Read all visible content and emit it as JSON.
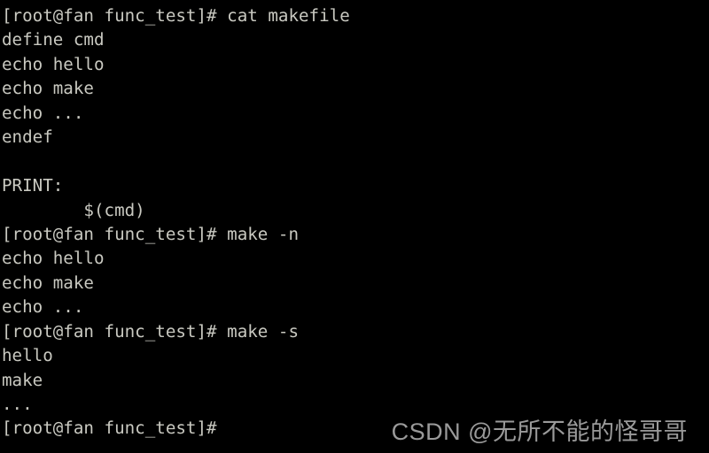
{
  "terminal": {
    "background_color": "#000000",
    "text_color": "#c9c9c1",
    "prompt": "[root@fan func_test]#",
    "lines": [
      {
        "id": "line-01-prompt-cat",
        "text": "[root@fan func_test]# cat makefile"
      },
      {
        "id": "line-02-define-cmd",
        "text": "define cmd"
      },
      {
        "id": "line-03-echo-hello",
        "text": "echo hello"
      },
      {
        "id": "line-04-echo-make",
        "text": "echo make"
      },
      {
        "id": "line-05-echo-dots",
        "text": "echo ..."
      },
      {
        "id": "line-06-endef",
        "text": "endef"
      },
      {
        "id": "line-07-blank",
        "text": ""
      },
      {
        "id": "line-08-print-target",
        "text": "PRINT:"
      },
      {
        "id": "line-09-cmd-expansion",
        "text": "        $(cmd)"
      },
      {
        "id": "line-10-prompt-make-n",
        "text": "[root@fan func_test]# make -n"
      },
      {
        "id": "line-11-echo-hello",
        "text": "echo hello"
      },
      {
        "id": "line-12-echo-make",
        "text": "echo make"
      },
      {
        "id": "line-13-echo-dots",
        "text": "echo ..."
      },
      {
        "id": "line-14-prompt-make-s",
        "text": "[root@fan func_test]# make -s"
      },
      {
        "id": "line-15-output-hello",
        "text": "hello"
      },
      {
        "id": "line-16-output-make",
        "text": "make"
      },
      {
        "id": "line-17-output-dots",
        "text": "..."
      },
      {
        "id": "line-18-prompt-final",
        "text": "[root@fan func_test]#"
      }
    ]
  },
  "watermark": {
    "text": "CSDN @无所不能的怪哥哥",
    "color": "#9a9a9a"
  }
}
